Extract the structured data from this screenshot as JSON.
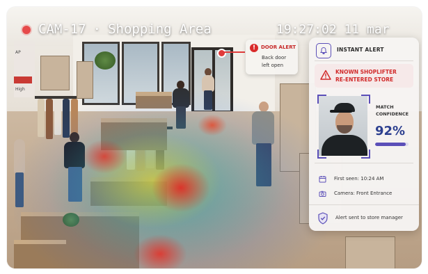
{
  "camera": {
    "id": "CAM-17",
    "separator": "·",
    "location": "Shopping Area",
    "time": "19:27:02",
    "date": "11 mar",
    "recording_indicator_color": "#e64a4a"
  },
  "door_alert": {
    "title": "DOOR ALERT",
    "line1": "Back door",
    "line2": "left open",
    "color": "#d92b2b"
  },
  "left_panel": {
    "label_partial": "AP",
    "level": "High",
    "bar_color": "#c93a34"
  },
  "alert_card": {
    "header": "INSTANT ALERT",
    "header_icon": "bell-icon",
    "threat_line1": "KNOWN SHOPLIFTER",
    "threat_line2": "RE-ENTERED STORE",
    "threat_color": "#d12a2a",
    "match_label_line1": "MATCH",
    "match_label_line2": "CONFIDENCE",
    "match_value": "92%",
    "match_fraction": 0.92,
    "first_seen": "First seen: 10:24 AM",
    "camera_source": "Camera: Front Entrance",
    "footer": "Alert sent to store manager",
    "accent_color": "#5b4fb8"
  },
  "heatmap": {
    "colors": [
      "#e61e1e",
      "#fad228",
      "#3cc878",
      "#286ee6"
    ]
  }
}
